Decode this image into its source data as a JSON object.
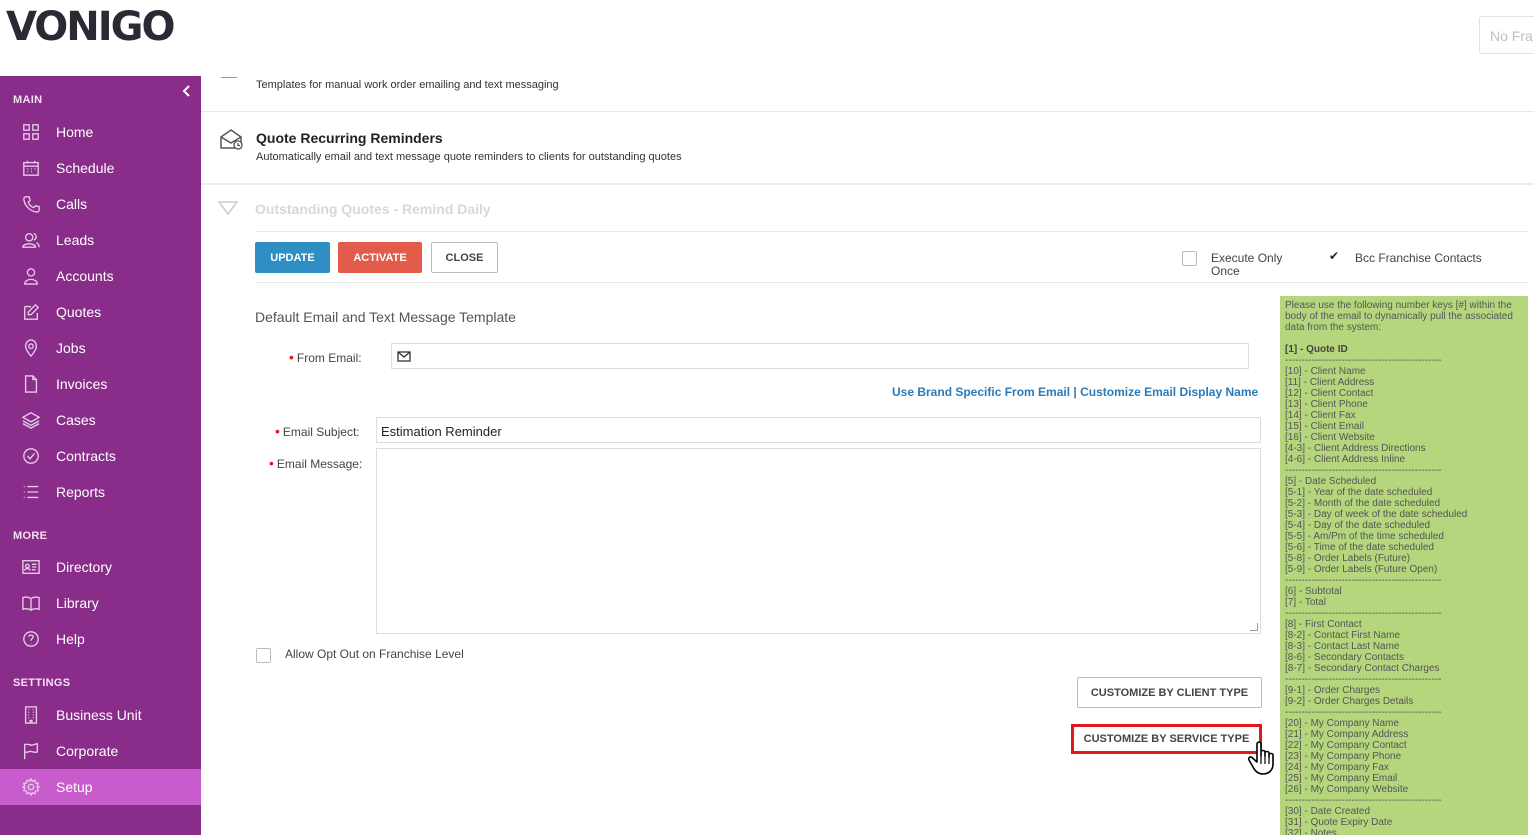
{
  "header": {
    "logo": "VONIGO",
    "franchise_selector": "No Fra"
  },
  "sidebar": {
    "collapse_icon": "chevron-left-icon",
    "sections": {
      "main": "MAIN",
      "more": "MORE",
      "settings": "SETTINGS"
    },
    "main_items": [
      {
        "label": "Home",
        "icon": "grid-icon"
      },
      {
        "label": "Schedule",
        "icon": "calendar-icon"
      },
      {
        "label": "Calls",
        "icon": "phone-icon"
      },
      {
        "label": "Leads",
        "icon": "users-icon"
      },
      {
        "label": "Accounts",
        "icon": "user-icon"
      },
      {
        "label": "Quotes",
        "icon": "edit-icon"
      },
      {
        "label": "Jobs",
        "icon": "map-pin-icon"
      },
      {
        "label": "Invoices",
        "icon": "file-icon"
      },
      {
        "label": "Cases",
        "icon": "layers-icon"
      },
      {
        "label": "Contracts",
        "icon": "check-circle-icon"
      },
      {
        "label": "Reports",
        "icon": "list-icon"
      }
    ],
    "more_items": [
      {
        "label": "Directory",
        "icon": "directory-icon"
      },
      {
        "label": "Library",
        "icon": "book-icon"
      },
      {
        "label": "Help",
        "icon": "help-circle-icon"
      }
    ],
    "settings_items": [
      {
        "label": "Business Unit",
        "icon": "building-icon"
      },
      {
        "label": "Corporate",
        "icon": "flag-icon"
      },
      {
        "label": "Setup",
        "icon": "gear-icon"
      }
    ],
    "active_item": "Setup",
    "colors": {
      "background": "#8a2c8a",
      "active": "#c85ccd"
    }
  },
  "main": {
    "top_card_desc": "Templates for manual work order emailing and text messaging",
    "reminders_card": {
      "title": "Quote Recurring Reminders",
      "desc": "Automatically email and text message quote reminders to clients for outstanding quotes"
    },
    "outstanding_title": "Outstanding Quotes - Remind Daily",
    "buttons": {
      "update": "UPDATE",
      "activate": "ACTIVATE",
      "close": "CLOSE"
    },
    "options": {
      "execute_once": "Execute Only Once",
      "execute_once_checked": false,
      "bcc_franchise": "Bcc Franchise Contacts",
      "bcc_franchise_checked": true
    },
    "form": {
      "section_title": "Default Email and Text Message Template",
      "from_email_label": "From Email:",
      "from_email_value": "",
      "brand_link": "Use Brand Specific From Email",
      "link_separator": "|",
      "display_name_link": "Customize Email Display Name",
      "subject_label": "Email Subject:",
      "subject_value": "Estimation Reminder",
      "message_label": "Email Message:",
      "message_value": "",
      "opt_out_label": "Allow Opt Out on Franchise Level",
      "opt_out_checked": false
    },
    "customize_client": "CUSTOMIZE BY CLIENT TYPE",
    "customize_service": "CUSTOMIZE BY SERVICE TYPE"
  },
  "keys_panel": {
    "intro": "Please use the following number keys [#] within the body of the email to dynamically pull the associated data from the system:",
    "groups": [
      [
        "[1] - Quote ID"
      ],
      [
        "[10] - Client Name",
        "[11] - Client Address",
        "[12] - Client Contact",
        "[13] - Client Phone",
        "[14] - Client Fax",
        "[15] - Client Email",
        "[16] - Client Website",
        "[4-3] - Client Address Directions",
        "[4-6] - Client Address Inline"
      ],
      [
        "[5] - Date Scheduled",
        "[5-1] - Year of the date scheduled",
        "[5-2] - Month of the date scheduled",
        "[5-3] - Day of week of the date scheduled",
        "[5-4] - Day of the date scheduled",
        "[5-5] - Am/Pm of the time scheduled",
        "[5-6] - Time of the date scheduled",
        "[5-8] - Order Labels (Future)",
        "[5-9] - Order Labels (Future Open)"
      ],
      [
        "[6] - Subtotal",
        "[7] - Total"
      ],
      [
        "[8] - First Contact",
        "[8-2] - Contact First Name",
        "[8-3] - Contact Last Name",
        "[8-6] - Secondary Contacts",
        "[8-7] - Secondary Contact Charges"
      ],
      [
        "[9-1] - Order Charges",
        "[9-2] - Order Charges Details"
      ],
      [
        "[20] - My Company Name",
        "[21] - My Company Address",
        "[22] - My Company Contact",
        "[23] - My Company Phone",
        "[24] - My Company Fax",
        "[25] - My Company Email",
        "[26] - My Company Website"
      ],
      [
        "[30] - Date Created",
        "[31] - Quote Expiry Date",
        "[32] - Notes"
      ]
    ],
    "separator": "-----------------------------------------------",
    "color": "#b5d67d"
  }
}
